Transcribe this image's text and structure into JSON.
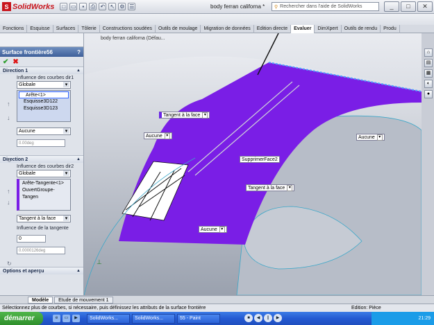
{
  "app": {
    "name": "SolidWorks",
    "doc_title": "body ferran californa *",
    "search_placeholder": "Rechercher dans l'aide de SolidWorks"
  },
  "window_buttons": [
    "_",
    "□",
    "✕"
  ],
  "tabs": [
    "Fonctions",
    "Esquisse",
    "Surfaces",
    "Tôlerie",
    "Constructions soudées",
    "Outils de moulage",
    "Migration de données",
    "Edition directe",
    "Evaluer",
    "DimXpert",
    "Outils de rendu",
    "Produ"
  ],
  "active_tab": "Evaluer",
  "tree_label": "body ferran californa (Défau...",
  "panel": {
    "title": "Surface frontière56",
    "help": "?",
    "ok": "✔",
    "cancel": "✖",
    "dir1": {
      "header": "Direction 1",
      "influence_label": "Influence des courbes dir1",
      "influence_value": "Globale",
      "items": [
        "Arête<1>",
        "Esquisse3D122",
        "Esquisse3D123"
      ],
      "tangent_value": "Aucune",
      "angle_value": "0.00deg"
    },
    "dir2": {
      "header": "Direction 2",
      "influence_label": "Influence des courbes dir2",
      "influence_value": "Globale",
      "items": [
        "Arête-Tangente<1>",
        "OuvertGroupe-Tangen"
      ],
      "tangent_value": "Tangent à la face",
      "tangent_influence_label": "Influence de la tangente",
      "tangent_influence_value": "0",
      "angle_value": "0.0000126deg"
    },
    "options_header": "Options et aperçu"
  },
  "callouts": {
    "tangent_top": "Tangent à la face",
    "aucune_left": "Aucune",
    "aucune_right": "Aucune",
    "supprimer": "SupprimerFace2",
    "tangent_mid": "Tangent à la face",
    "aucune_bottom": "Aucune"
  },
  "bottom_tabs": [
    "Modèle",
    "Etude de mouvement 1"
  ],
  "status": {
    "message": "Sélectionnez plus de courbes, si nécessaire, puis définissez les attributs de la surface frontière",
    "mode": "Edition: Pièce"
  },
  "taskbar": {
    "start": "démarrer",
    "tasks": [
      "SolidWorks...",
      "SolidWorks...",
      "55 - Paint"
    ],
    "clock": "21:29"
  },
  "colors": {
    "surface": "#7a1ee6",
    "accent": "#3e5f9a",
    "taskbar": "#245ad2"
  }
}
